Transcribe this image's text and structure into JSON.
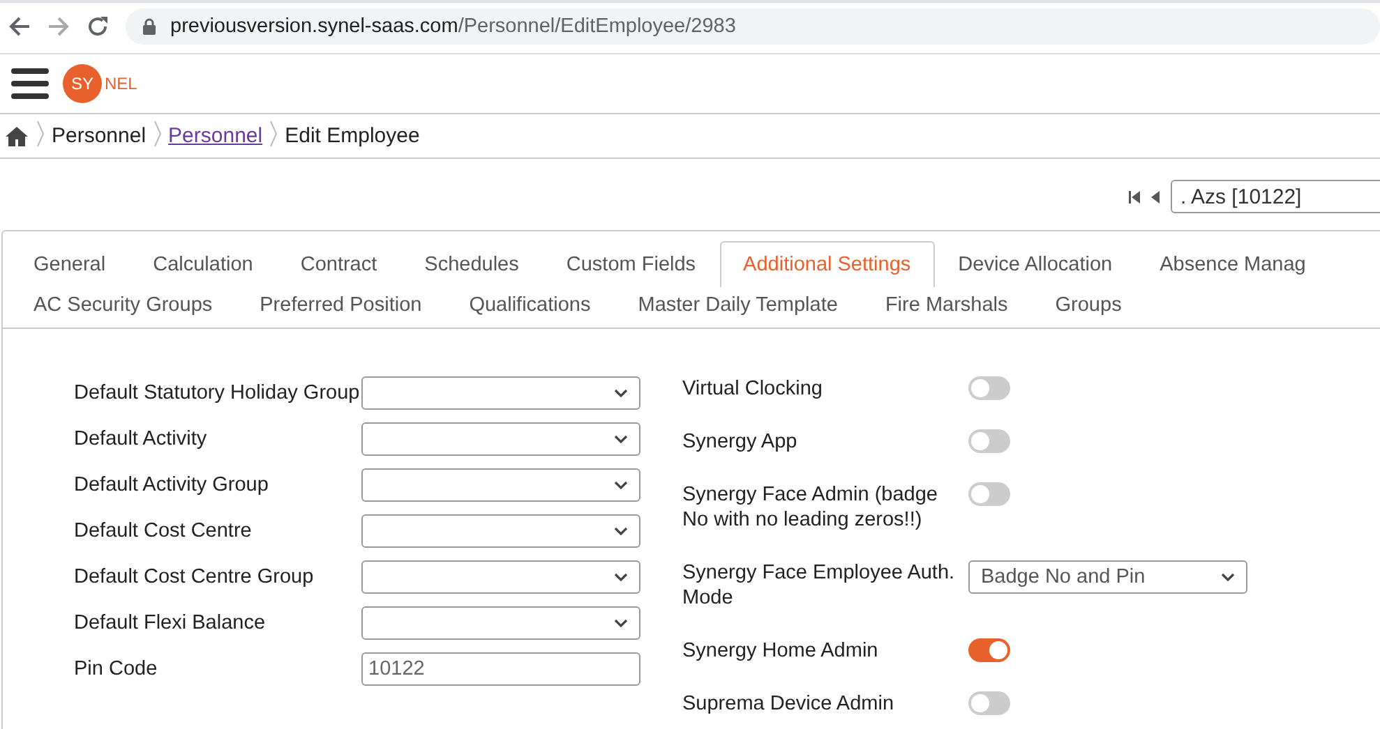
{
  "browser": {
    "url_host": "previousversion.synel-saas.com",
    "url_path": "/Personnel/EditEmployee/2983"
  },
  "header": {
    "logo_badge": "SY",
    "logo_rest": "NEL"
  },
  "breadcrumb": [
    {
      "label": "Personnel",
      "kind": "text"
    },
    {
      "label": "Personnel",
      "kind": "link"
    },
    {
      "label": "Edit Employee",
      "kind": "text"
    }
  ],
  "employee_nav": {
    "value": ". Azs [10122]"
  },
  "tabs": [
    [
      {
        "label": "General",
        "selected": false
      },
      {
        "label": "Calculation",
        "selected": false
      },
      {
        "label": "Contract",
        "selected": false
      },
      {
        "label": "Schedules",
        "selected": false
      },
      {
        "label": "Custom Fields",
        "selected": false
      },
      {
        "label": "Additional Settings",
        "selected": true
      },
      {
        "label": "Device Allocation",
        "selected": false
      },
      {
        "label": "Absence Manag",
        "selected": false
      }
    ],
    [
      {
        "label": "AC Security Groups",
        "selected": false
      },
      {
        "label": "Preferred Position",
        "selected": false
      },
      {
        "label": "Qualifications",
        "selected": false
      },
      {
        "label": "Master Daily Template",
        "selected": false
      },
      {
        "label": "Fire Marshals",
        "selected": false
      },
      {
        "label": "Groups",
        "selected": false
      }
    ]
  ],
  "left_fields": [
    {
      "label": "Default Statutory Holiday Group",
      "kind": "select"
    },
    {
      "label": "Default Activity",
      "kind": "select"
    },
    {
      "label": "Default Activity Group",
      "kind": "select"
    },
    {
      "label": "Default Cost Centre",
      "kind": "select"
    },
    {
      "label": "Default Cost Centre Group",
      "kind": "select"
    },
    {
      "label": "Default Flexi Balance",
      "kind": "select"
    },
    {
      "label": "Pin Code",
      "kind": "text",
      "value": "10122"
    }
  ],
  "right_fields": [
    {
      "label": "Virtual Clocking",
      "kind": "toggle",
      "on": false
    },
    {
      "label": "Synergy App",
      "kind": "toggle",
      "on": false
    },
    {
      "label": "Synergy Face Admin (badge No with no leading zeros!!)",
      "kind": "toggle",
      "on": false
    },
    {
      "label": "Synergy Face Employee Auth. Mode",
      "kind": "select",
      "value": "Badge No and Pin"
    },
    {
      "label": "Synergy Home Admin",
      "kind": "toggle",
      "on": true
    },
    {
      "label": "Suprema Device Admin",
      "kind": "toggle",
      "on": false
    }
  ]
}
